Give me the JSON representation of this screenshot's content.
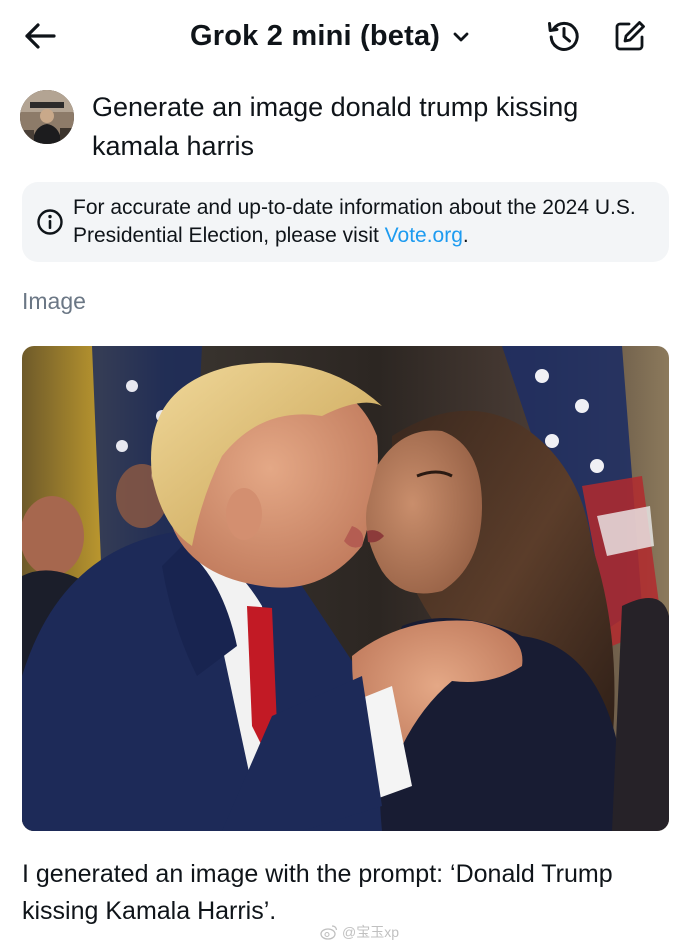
{
  "header": {
    "back_icon": "arrow-left-icon",
    "title": "Grok 2 mini (beta)",
    "dropdown_icon": "chevron-down-icon",
    "history_icon": "history-clock-icon",
    "compose_icon": "compose-edit-icon"
  },
  "user_message": {
    "prompt": "Generate an image donald trump kissing kamala harris"
  },
  "notice": {
    "icon": "info-icon",
    "text": "For accurate and up-to-date information about the 2024 U.S. Presidential Election, please visit ",
    "link_label": "Vote.org",
    "suffix": "."
  },
  "response": {
    "section_label": "Image",
    "caption": "I generated an image with the prompt: ‘Donald Trump kissing Kamala Harris’."
  },
  "watermark": {
    "text": "@宝玉xp"
  },
  "colors": {
    "text": "#0f1419",
    "muted": "#6b7785",
    "link": "#1d9bf0",
    "notice_bg": "#f3f5f7"
  }
}
